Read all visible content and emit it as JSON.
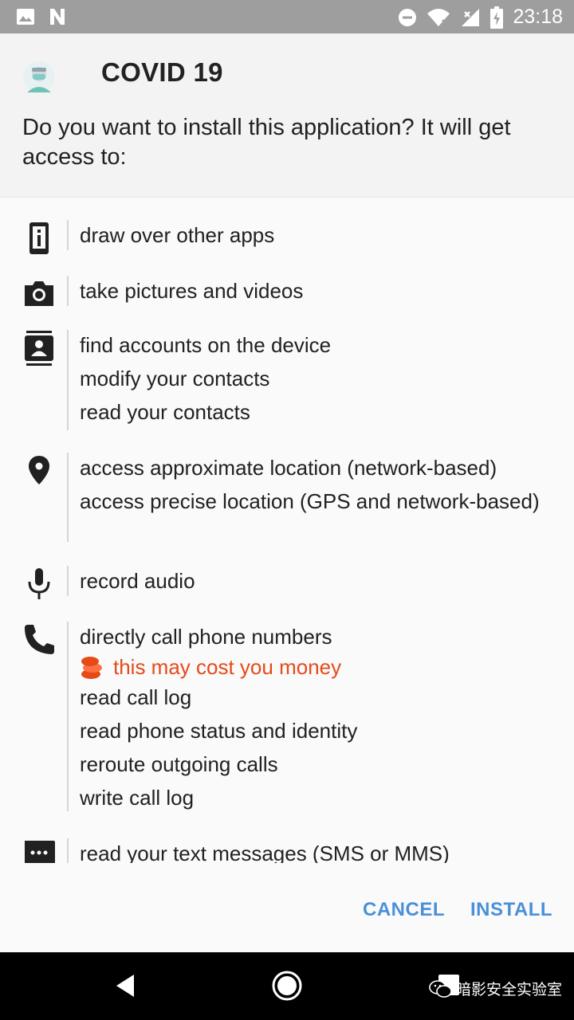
{
  "status_bar": {
    "time": "23:18",
    "icons": [
      "image-icon",
      "n-logo-icon",
      "dnd-icon",
      "wifi-icon",
      "signal-icon",
      "battery-icon"
    ]
  },
  "dialog": {
    "app_name": "COVID 19",
    "prompt": "Do you want to install this application? It will get access to:",
    "permission_groups": [
      {
        "icon": "phone-device-icon",
        "items": [
          "draw over other apps"
        ]
      },
      {
        "icon": "camera-icon",
        "items": [
          "take pictures and videos"
        ]
      },
      {
        "icon": "contacts-icon",
        "items": [
          "find accounts on the device",
          "modify your contacts",
          "read your contacts"
        ]
      },
      {
        "icon": "location-pin-icon",
        "items": [
          "access approximate location (network-based)",
          "access precise location (GPS and network-based)"
        ]
      },
      {
        "icon": "microphone-icon",
        "items": [
          "record audio"
        ]
      },
      {
        "icon": "phone-call-icon",
        "items": [
          "directly call phone numbers"
        ],
        "warning": "this may cost you money",
        "more_items": [
          "read call log",
          "read phone status and identity",
          "reroute outgoing calls",
          "write call log"
        ]
      },
      {
        "icon": "message-icon",
        "items": [
          "read your text messages (SMS or MMS)"
        ]
      }
    ],
    "buttons": {
      "cancel": "CANCEL",
      "install": "INSTALL"
    },
    "warning_color": "#e64a19",
    "accent_color": "#4a90d9"
  },
  "nav_bar": {
    "icons": [
      "back-icon",
      "home-icon",
      "recents-icon"
    ],
    "watermark": "暗影安全实验室"
  }
}
